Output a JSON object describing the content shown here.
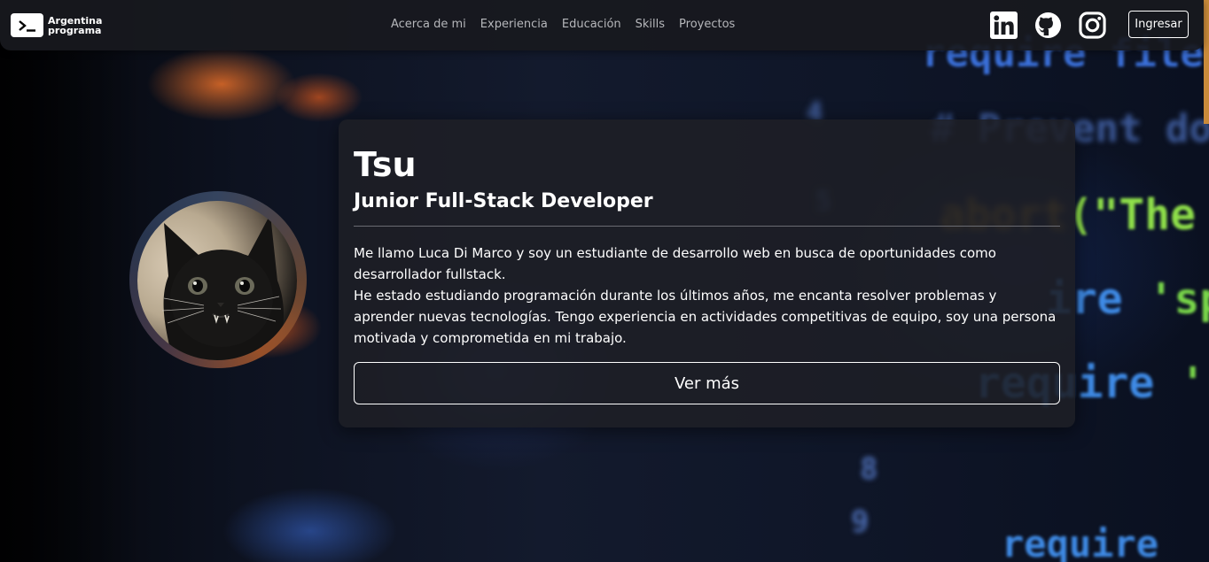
{
  "brand": {
    "name_line1": "Argentina",
    "name_line2": "programa",
    "icon": "terminal-icon"
  },
  "nav": {
    "links": [
      "Acerca de mi",
      "Experiencia",
      "Educación",
      "Skills",
      "Proyectos"
    ]
  },
  "social": [
    {
      "name": "linkedin",
      "icon": "linkedin-icon"
    },
    {
      "name": "github",
      "icon": "github-icon"
    },
    {
      "name": "instagram",
      "icon": "instagram-icon"
    }
  ],
  "login_label": "Ingresar",
  "profile": {
    "name": "Tsu",
    "role": "Junior Full-Stack Developer",
    "about_p1": "Me llamo Luca Di Marco y soy un estudiante de desarrollo web en busca de oportunidades como desarrollador fullstack.",
    "about_p2": "He estado estudiando programación durante los últimos años, me encanta resolver problemas y aprender nuevas tecnologías. Tengo experiencia en actividades competitivas de equipo, soy una persona motivada y comprometida en mi trabajo.",
    "more_label": "Ver más"
  },
  "colors": {
    "navbar_bg": "#18191e",
    "card_bg": "#1e1f26",
    "accent_orange": "#c98a3a"
  }
}
